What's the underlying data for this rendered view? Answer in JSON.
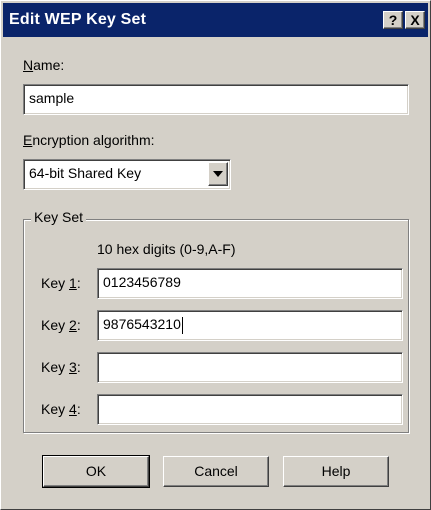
{
  "window": {
    "title": "Edit WEP Key Set",
    "help_glyph": "?",
    "close_glyph": "X"
  },
  "name": {
    "label_mnemonic": "N",
    "label_rest": "ame:",
    "value": "sample"
  },
  "encryption": {
    "label_mnemonic": "E",
    "label_rest": "ncryption algorithm:",
    "selected": "64-bit Shared Key"
  },
  "key_set": {
    "title": "Key Set",
    "hint": "10 hex digits (0-9,A-F)",
    "keys": [
      {
        "label_prefix": "Key ",
        "label_mnemonic": "1",
        "label_suffix": ":",
        "value": "0123456789"
      },
      {
        "label_prefix": "Key ",
        "label_mnemonic": "2",
        "label_suffix": ":",
        "value": "9876543210"
      },
      {
        "label_prefix": "Key ",
        "label_mnemonic": "3",
        "label_suffix": ":",
        "value": ""
      },
      {
        "label_prefix": "Key ",
        "label_mnemonic": "4",
        "label_suffix": ":",
        "value": ""
      }
    ]
  },
  "buttons": {
    "ok": "OK",
    "cancel": "Cancel",
    "help": "Help"
  }
}
